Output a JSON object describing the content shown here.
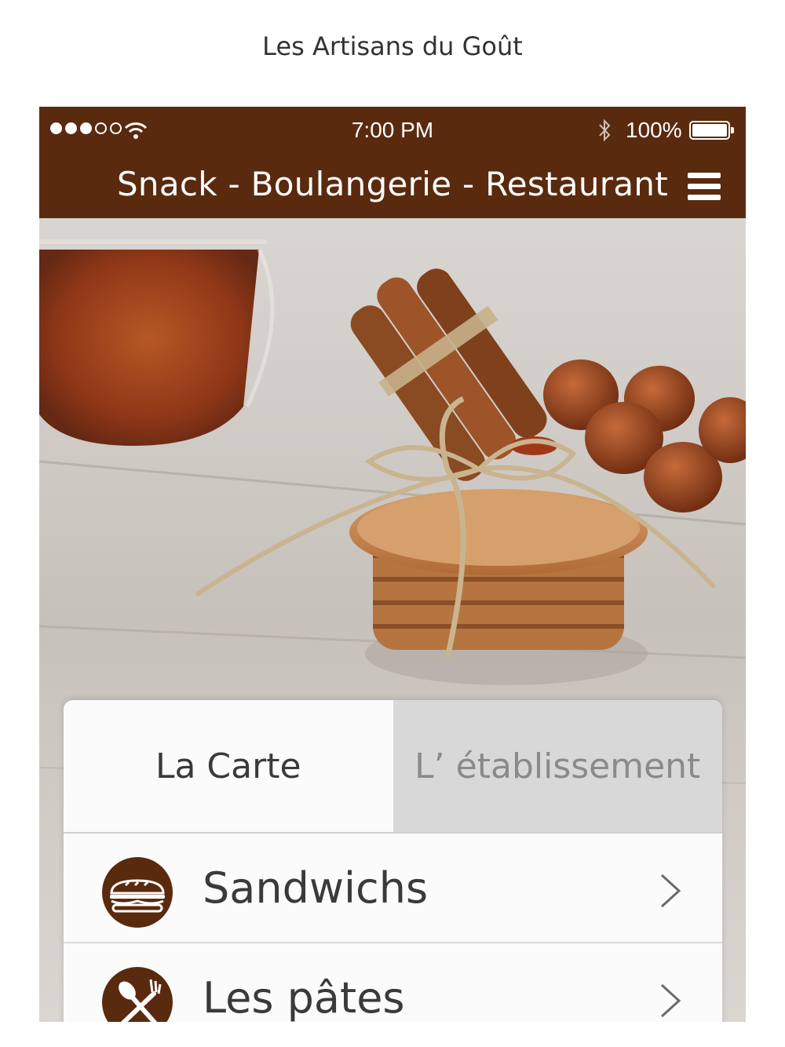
{
  "caption": "Les Artisans du Goût",
  "status_bar": {
    "time": "7:00 PM",
    "battery": "100%",
    "signal_icon": "signal-dots-icon",
    "wifi_icon": "wifi-icon",
    "bluetooth_icon": "bluetooth-icon"
  },
  "header": {
    "title": "Snack - Boulangerie - Restaurant",
    "menu_icon": "hamburger-menu-icon",
    "background": "#5a2a0e"
  },
  "hero": {
    "description": "photo"
  },
  "tabs": [
    {
      "label": "La Carte",
      "active": true
    },
    {
      "label": "L’ établissement",
      "active": false
    }
  ],
  "menu_items": [
    {
      "label": "Sandwichs",
      "icon": "sandwich-icon"
    },
    {
      "label": "Les pâtes",
      "icon": "fork-knife-icon"
    }
  ],
  "colors": {
    "brand_brown": "#5a2a0e",
    "inactive_tab": "#d8d8d8"
  }
}
